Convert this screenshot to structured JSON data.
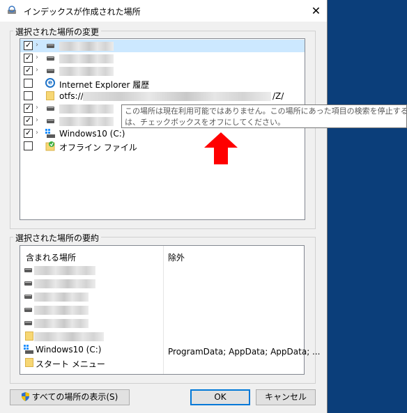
{
  "window": {
    "title": "インデックスが作成された場所",
    "close_glyph": "✕"
  },
  "locations_group": {
    "label": "選択された場所の変更",
    "items": [
      {
        "checked": true,
        "expandable": true,
        "icon": "drive-icon",
        "text": "",
        "redacted": true
      },
      {
        "checked": true,
        "expandable": true,
        "icon": "drive-icon",
        "text": "",
        "redacted": true
      },
      {
        "checked": true,
        "expandable": true,
        "icon": "drive-icon",
        "text": "",
        "redacted": true
      },
      {
        "checked": false,
        "expandable": false,
        "icon": "ie-icon",
        "text": "Internet Explorer 履歴"
      },
      {
        "checked": false,
        "expandable": false,
        "icon": "folder-icon",
        "text": "otfs://",
        "suffix": "/Z/",
        "redacted": true
      },
      {
        "checked": true,
        "expandable": true,
        "icon": "drive-icon",
        "text": "",
        "redacted": true
      },
      {
        "checked": true,
        "expandable": true,
        "icon": "drive-icon",
        "text": "",
        "redacted": true
      },
      {
        "checked": true,
        "expandable": true,
        "icon": "windows-drive-icon",
        "text": "Windows10 (C:)"
      },
      {
        "checked": false,
        "expandable": false,
        "icon": "offline-files-icon",
        "text": "オフライン ファイル"
      }
    ]
  },
  "tooltip": {
    "line1": "この場所は現在利用可能ではありません。この場所にあった項目の検索を停止するに",
    "line2": "は、チェックボックスをオフにしてください。"
  },
  "summary_group": {
    "label": "選択された場所の要約",
    "included_header": "含まれる場所",
    "excluded_header": "除外",
    "included": [
      {
        "icon": "drive-icon",
        "text": "",
        "redacted": true
      },
      {
        "icon": "drive-icon",
        "text": "",
        "redacted": true
      },
      {
        "icon": "drive-icon",
        "text": "",
        "redacted": true
      },
      {
        "icon": "drive-icon",
        "text": "",
        "redacted": true
      },
      {
        "icon": "drive-icon",
        "text": "",
        "redacted": true
      },
      {
        "icon": "folder-icon",
        "text": "",
        "redacted": true
      },
      {
        "icon": "windows-drive-icon",
        "text": "Windows10 (C:)"
      },
      {
        "icon": "folder-icon",
        "text": "スタート メニュー"
      }
    ],
    "excluded_windows": "ProgramData; AppData; AppData; ..."
  },
  "buttons": {
    "show_all": "すべての場所の表示(S)",
    "ok": "OK",
    "cancel": "キャンセル"
  },
  "colors": {
    "desktop": "#0b3e7a",
    "selection": "#cce8ff",
    "annotation_arrow": "#ff0000",
    "default_button_border": "#0078d7"
  }
}
